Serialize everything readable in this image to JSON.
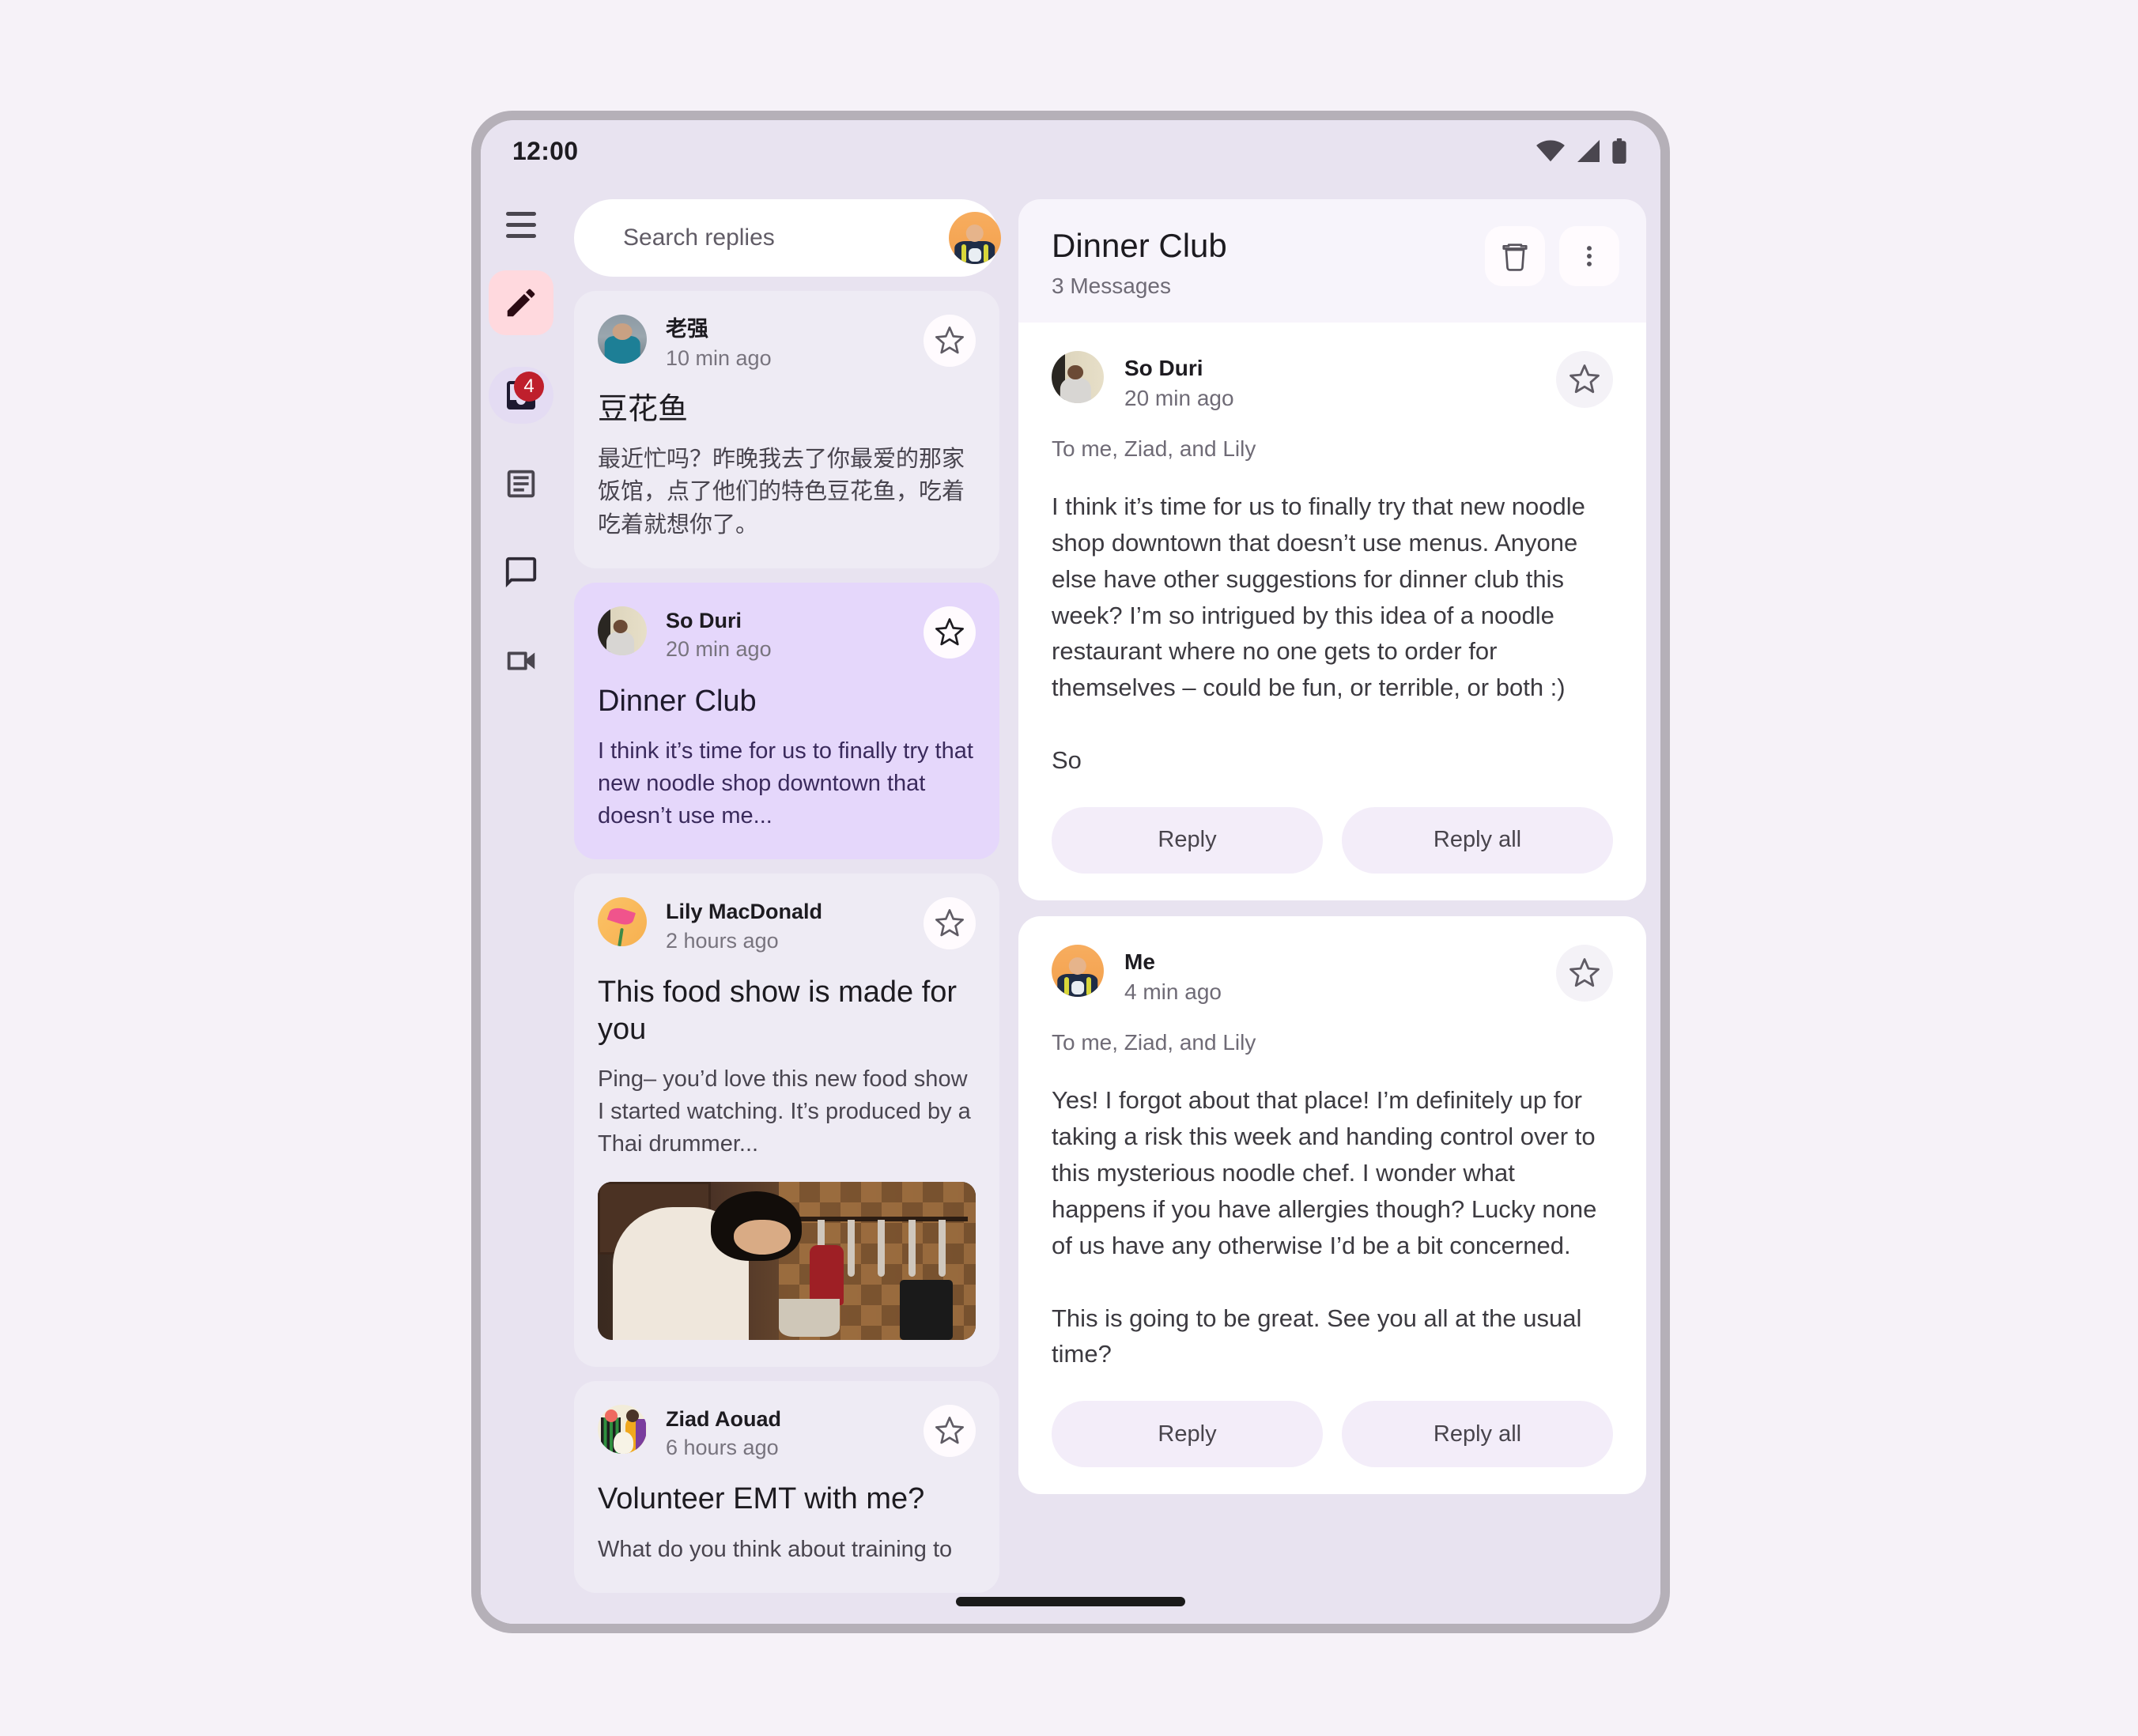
{
  "status_bar": {
    "time": "12:00",
    "icons": [
      "wifi-icon",
      "cellular-signal-icon",
      "battery-icon"
    ]
  },
  "nav_rail": {
    "menu_label": "menu-icon",
    "compose_label": "compose-icon",
    "items": [
      {
        "name": "inbox",
        "icon": "inbox-icon",
        "badge": "4",
        "active": true
      },
      {
        "name": "articles",
        "icon": "article-icon",
        "badge": "",
        "active": false
      },
      {
        "name": "chat",
        "icon": "chat-bubble-icon",
        "badge": "",
        "active": false
      },
      {
        "name": "video",
        "icon": "video-camera-icon",
        "badge": "",
        "active": false
      }
    ]
  },
  "search": {
    "placeholder": "Search replies",
    "value": "",
    "icon": "search-icon",
    "avatar": "account-avatar"
  },
  "email_list": [
    {
      "sender": "老强",
      "time": "10 min ago",
      "subject": "豆花鱼",
      "preview": "最近忙吗？昨晚我去了你最爱的那家饭馆，点了他们的特色豆花鱼，吃着吃着就想你了。",
      "starred": false,
      "selected": false,
      "has_image": false,
      "avatar_class": "av-laoqiang"
    },
    {
      "sender": "So Duri",
      "time": "20 min ago",
      "subject": "Dinner Club",
      "preview": "I think it’s time for us to finally try that new noodle shop downtown that doesn’t use me...",
      "starred": false,
      "selected": true,
      "has_image": false,
      "avatar_class": "av-soduri"
    },
    {
      "sender": "Lily MacDonald",
      "time": "2 hours ago",
      "subject": "This food show is made for you",
      "preview": "Ping– you’d love this new food show I started watching. It’s produced by a Thai drummer...",
      "starred": false,
      "selected": false,
      "has_image": true,
      "image_alt": "woman-baking-in-kitchen-photo",
      "avatar_class": "av-lily"
    },
    {
      "sender": "Ziad Aouad",
      "time": "6 hours ago",
      "subject": "Volunteer EMT with me?",
      "preview": "What do you think about training to",
      "starred": false,
      "selected": false,
      "has_image": false,
      "avatar_class": "av-ziad"
    }
  ],
  "detail": {
    "title": "Dinner Club",
    "subtitle": "3 Messages",
    "delete_icon": "trash-icon",
    "more_icon": "more-vertical-icon",
    "messages": [
      {
        "sender": "So Duri",
        "time": "20 min ago",
        "recipients": "To me, Ziad, and Lily",
        "body": "I think it’s time for us to finally try that new noodle shop downtown that doesn’t use menus. Anyone else have other suggestions for dinner club this week? I’m so intrigued by this idea of a noodle restaurant where no one gets to order for themselves – could be fun, or terrible, or both :)\n\nSo",
        "starred": false,
        "avatar_class": "av-soduri",
        "reply_label": "Reply",
        "reply_all_label": "Reply all"
      },
      {
        "sender": "Me",
        "time": "4 min ago",
        "recipients": "To me, Ziad, and Lily",
        "body": "Yes! I forgot about that place! I’m definitely up for taking a risk this week and handing control over to this mysterious noodle chef. I wonder what happens if you have allergies though? Lucky none of us have any otherwise I’d be a bit concerned.\n\nThis is going to be great. See you all at the usual time?",
        "starred": false,
        "avatar_class": "av-me",
        "reply_label": "Reply",
        "reply_all_label": "Reply all"
      }
    ]
  },
  "colors": {
    "page_background": "#f6f2f8",
    "device_bezel": "#b5b0b8",
    "surface": "#e8e3f0",
    "card": "#eeebf4",
    "card_selected": "#e5d7fb",
    "accent_pink": "#ffd9de",
    "badge_red": "#bf1f2c",
    "button_tonal": "#f3edf9",
    "on_surface": "#1d1b20"
  }
}
